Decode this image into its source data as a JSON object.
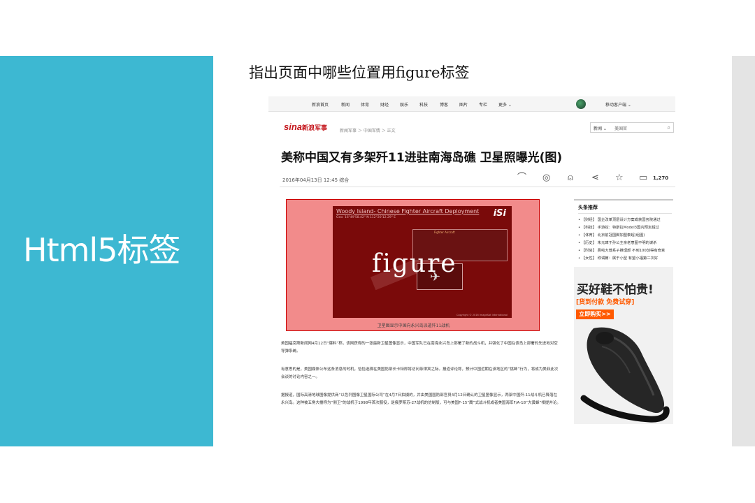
{
  "slide": {
    "title": "Html5标签",
    "question": "指出页面中哪些位置用figure标签",
    "accent_color": "#3db8d2"
  },
  "webpage": {
    "nav": {
      "items": [
        "新浪首页",
        "新闻",
        "体育",
        "财经",
        "娱乐",
        "科技",
        "博客",
        "图片",
        "专栏",
        "更多 ⌄"
      ],
      "client": "移动客户端 ⌄"
    },
    "logo": "sina",
    "logo_name": "新浪军事",
    "breadcrumb": "新闻军事 ＞ 中国军情 ＞ 正文",
    "search": {
      "type": "新闻 ⌄",
      "value": "美国官"
    },
    "headline": "美称中国又有多架歼11进驻南海岛礁 卫星照曝光(图)",
    "meta": "2016年04月13日 12:45   综合",
    "comment_count": "1,270",
    "figure": {
      "title": "Woody Island- Chinese Fighter Aircraft Deployment",
      "coords": "Geo: 16°49'58.42\" N 112°20'12.29\" E",
      "logo": "iSi",
      "overlay_label": "figure",
      "caption": "卫星图显示中国向永兴岛派遣歼11战机",
      "copyright": "Copyright © 2016 ImageSat International"
    },
    "paragraphs": [
      "美国福克斯新闻网4月12日“爆料”称，该网获得的一张最新卫星图像显示，中国军队已在南海永兴岛上部署了新的战斗机，并强化了中国在该岛上部署的先进地对空导弹系统。",
      "有意思的是，美国媒体公布这条消息的时机，恰恰选择在美国防部长卡特即将访问菲律宾之际。报道评论称，预计中国近期在该地区的“挑衅”行为，将成为美菲此次会谈的讨论内容之一。",
      "据报道，国际高清地球图像提供商“以色列图像卫星国际公司”在4月7日拍摄的，并由美国国防部官员4月12日确认的卫星图像显示，两架中国歼-11战斗机已降落在永兴岛。这种被五角大楼称为“侧卫”的战机于1998年首次服役，是俄罗斯苏-27战机的仿制版，可与美国F-15“鹰”式战斗机或者美国海军F/A-18“大黄蜂”相提并论。"
    ],
    "sidebar": {
      "title": "头条推荐",
      "links": [
        "• 【财经】 国企改革顶层设计方案或获国务院通过",
        "• 【科技】 手游控：特斯拉Model3国内预定超过",
        "• 【体育】 北京前冠国脚加盟泰超(组图)",
        "• 【历史】 朱元璋于孙公主亲老意图不明的谋杀",
        "• 【时尚】 费啦大尊系子推理部  不到100创得有奇意",
        "• 【女性】 称谓篇：属于小型 有望小福第二次好"
      ]
    },
    "ad": {
      "headline": "买好鞋不怕贵!",
      "subline": "[货到付款 免费试穿]",
      "button": "立即购买>>"
    }
  }
}
